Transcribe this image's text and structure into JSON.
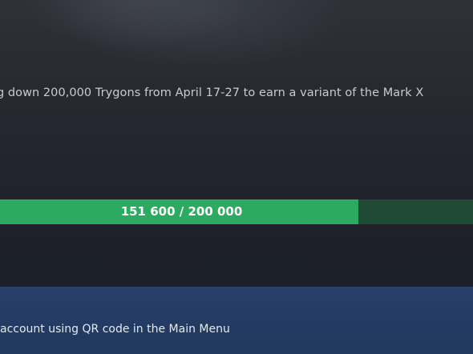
{
  "event": {
    "description": "g down 200,000 Trygons from April 17-27 to earn a variant of the Mark X"
  },
  "progress": {
    "current": 151600,
    "target": 200000,
    "fraction": 0.758,
    "label": "151 600 / 200 000"
  },
  "banner": {
    "text": "account using QR code in the Main Menu"
  }
}
